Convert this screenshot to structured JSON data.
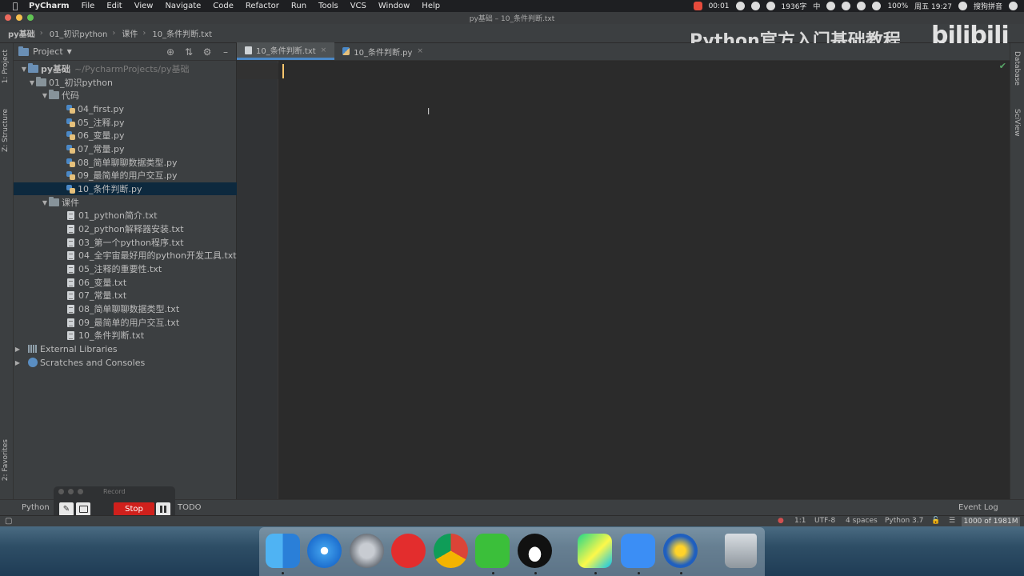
{
  "menubar": {
    "apple": "",
    "items": [
      "PyCharm",
      "File",
      "Edit",
      "View",
      "Navigate",
      "Code",
      "Refactor",
      "Run",
      "Tools",
      "VCS",
      "Window",
      "Help"
    ],
    "status": {
      "battery_time": "00:01",
      "word_count": "1936字",
      "input_lang": "中",
      "battery": "100%",
      "clock": "周五 19:27",
      "ime": "搜狗拼音"
    }
  },
  "window": {
    "title": "py基础 – 10_条件判断.txt"
  },
  "navbar": {
    "crumbs": [
      "py基础",
      "01_初识python",
      "课件",
      "10_条件判断.txt"
    ]
  },
  "watermark": {
    "text": "Python官方入门基础教程",
    "brand": "bilibili"
  },
  "left_strip": {
    "project_tab": "1: Project",
    "structure_tab": "Z: Structure",
    "favorites_tab": "2: Favorites"
  },
  "right_strip": {
    "database_tab": "Database",
    "sciview_tab": "SciView"
  },
  "project": {
    "header": "Project",
    "root": {
      "name": "py基础",
      "path": "~/PycharmProjects/py基础"
    },
    "folder1": "01_初识python",
    "code_folder": "代码",
    "code_files": [
      "04_first.py",
      "05_注释.py",
      "06_变量.py",
      "07_常量.py",
      "08_简单聊聊数据类型.py",
      "09_最简单的用户交互.py",
      "10_条件判断.py"
    ],
    "course_folder": "课件",
    "course_files": [
      "01_python简介.txt",
      "02_python解释器安装.txt",
      "03_第一个python程序.txt",
      "04_全宇宙最好用的python开发工具.txt",
      "05_注释的重要性.txt",
      "06_变量.txt",
      "07_常量.txt",
      "08_简单聊聊数据类型.txt",
      "09_最简单的用户交互.txt",
      "10_条件判断.txt"
    ],
    "external": "External Libraries",
    "scratches": "Scratches and Consoles"
  },
  "editor": {
    "tabs": [
      {
        "label": "10_条件判断.txt",
        "active": true
      },
      {
        "label": "10_条件判断.py",
        "active": false
      }
    ]
  },
  "bottom_tools": {
    "python": "Python",
    "todo": "TODO",
    "event_log": "Event Log"
  },
  "record": {
    "title": "Record",
    "stop": "Stop"
  },
  "statusbar": {
    "position": "1:1",
    "encoding": "UTF-8",
    "indent": "4 spaces",
    "interpreter": "Python 3.7",
    "memory": "1000 of 1981M"
  },
  "colors": {
    "accent": "#4a88c7",
    "selection": "#0d293e",
    "caret": "#ffc66d",
    "stop": "#d0201c"
  },
  "dock": {
    "icons": [
      "finder-icon",
      "safari-icon",
      "launchpad-icon",
      "netease-music-icon",
      "chrome-icon",
      "wechat-icon",
      "qq-icon",
      "pycharm-icon",
      "note-icon",
      "thunder-icon",
      "trash-icon"
    ]
  }
}
